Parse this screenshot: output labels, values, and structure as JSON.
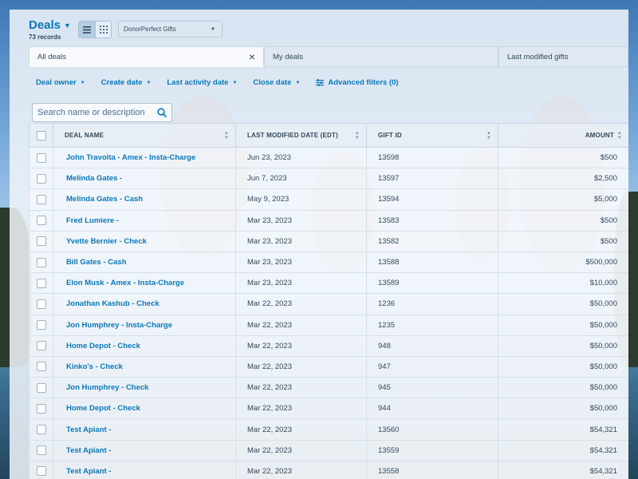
{
  "header": {
    "title": "Deals",
    "records": "73 records"
  },
  "view_toggle": {
    "list_icon": "list-view-icon",
    "grid_icon": "grid-view-icon"
  },
  "pipeline": {
    "selected": "DonorPerfect Gifts"
  },
  "tabs": [
    {
      "label": "All deals",
      "active": true
    },
    {
      "label": "My deals",
      "active": false
    },
    {
      "label": "Last modified gifts",
      "active": false
    }
  ],
  "filters": {
    "items": [
      "Deal owner",
      "Create date",
      "Last activity date",
      "Close date"
    ],
    "advanced": "Advanced filters (0)"
  },
  "search": {
    "placeholder": "Search name or description"
  },
  "table": {
    "columns": [
      "DEAL NAME",
      "LAST MODIFIED DATE (EDT)",
      "GIFT ID",
      "AMOUNT"
    ],
    "rows": [
      {
        "deal": "John Travolta - Amex - Insta-Charge",
        "date": "Jun 23, 2023",
        "gift_id": "13598",
        "amount": "$500"
      },
      {
        "deal": "Melinda Gates -",
        "date": "Jun 7, 2023",
        "gift_id": "13597",
        "amount": "$2,500"
      },
      {
        "deal": "Melinda Gates - Cash",
        "date": "May 9, 2023",
        "gift_id": "13594",
        "amount": "$5,000"
      },
      {
        "deal": "Fred Lumiere -",
        "date": "Mar 23, 2023",
        "gift_id": "13583",
        "amount": "$500"
      },
      {
        "deal": "Yvette Bernier - Check",
        "date": "Mar 23, 2023",
        "gift_id": "13582",
        "amount": "$500"
      },
      {
        "deal": "Bill Gates - Cash",
        "date": "Mar 23, 2023",
        "gift_id": "13588",
        "amount": "$500,000"
      },
      {
        "deal": "Elon Musk - Amex - Insta-Charge",
        "date": "Mar 23, 2023",
        "gift_id": "13589",
        "amount": "$10,000"
      },
      {
        "deal": "Jonathan Kashub - Check",
        "date": "Mar 22, 2023",
        "gift_id": "1236",
        "amount": "$50,000"
      },
      {
        "deal": "Jon Humphrey - Insta-Charge",
        "date": "Mar 22, 2023",
        "gift_id": "1235",
        "amount": "$50,000"
      },
      {
        "deal": "Home Depot - Check",
        "date": "Mar 22, 2023",
        "gift_id": "948",
        "amount": "$50,000"
      },
      {
        "deal": "Kinko's - Check",
        "date": "Mar 22, 2023",
        "gift_id": "947",
        "amount": "$50,000"
      },
      {
        "deal": "Jon Humphrey - Check",
        "date": "Mar 22, 2023",
        "gift_id": "945",
        "amount": "$50,000"
      },
      {
        "deal": "Home Depot - Check",
        "date": "Mar 22, 2023",
        "gift_id": "944",
        "amount": "$50,000"
      },
      {
        "deal": "Test Apiant -",
        "date": "Mar 22, 2023",
        "gift_id": "13560",
        "amount": "$54,321"
      },
      {
        "deal": "Test Apiant -",
        "date": "Mar 22, 2023",
        "gift_id": "13559",
        "amount": "$54,321"
      },
      {
        "deal": "Test Apiant -",
        "date": "Mar 22, 2023",
        "gift_id": "13558",
        "amount": "$54,321"
      }
    ]
  },
  "colors": {
    "accent": "#0a78b8",
    "text": "#33475b"
  }
}
